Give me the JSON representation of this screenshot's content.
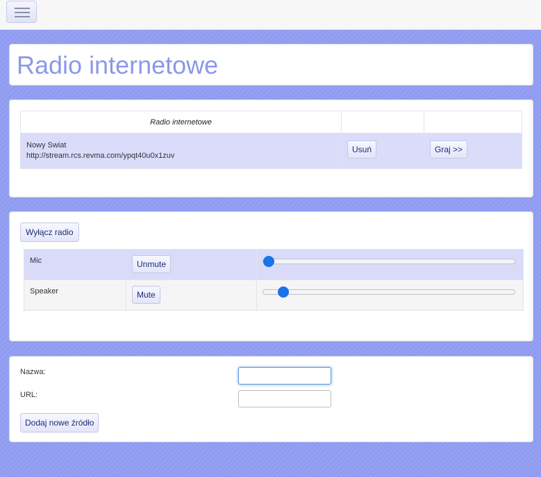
{
  "header": {
    "menu_icon": "hamburger-menu-icon"
  },
  "page": {
    "title": "Radio internetowe"
  },
  "stations": {
    "caption": "Radio internetowe",
    "items": [
      {
        "name": "Nowy Swiat",
        "url": "http://stream.rcs.revma.com/ypqt40u0x1zuv",
        "remove_label": "Usuń",
        "play_label": "Graj >>"
      }
    ]
  },
  "audio": {
    "radio_off_label": "Wyłącz radio",
    "channels": [
      {
        "name": "Mic",
        "button_label": "Unmute",
        "level": 0
      },
      {
        "name": "Speaker",
        "button_label": "Mute",
        "level": 0.06
      }
    ]
  },
  "add_source": {
    "name_label": "Nazwa:",
    "name_value": "",
    "url_label": "URL:",
    "url_value": "",
    "submit_label": "Dodaj nowe źródło"
  },
  "colors": {
    "background": "#8f9bf0",
    "title": "#8b98ea",
    "row_highlight": "#dadcfa",
    "slider_thumb": "#1a73e8",
    "button_text": "#1e2b72"
  }
}
